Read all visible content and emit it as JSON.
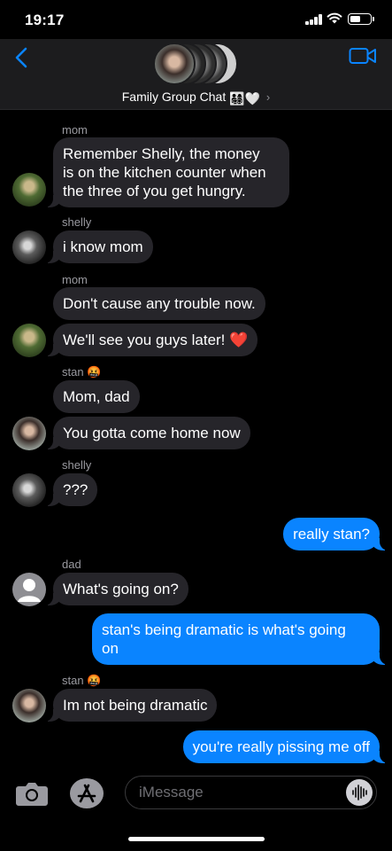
{
  "status": {
    "time": "19:17"
  },
  "header": {
    "title": "Family Group Chat",
    "title_emoji": "👨‍👩‍👧‍👦🤍",
    "chevron": "›"
  },
  "messages": [
    {
      "sender": "mom",
      "text_lines": [
        "Remember Shelly, the money",
        "is on the kitchen counter when",
        "the three of you get hungry."
      ],
      "direction": "received"
    },
    {
      "sender": "shelly",
      "text": "i know mom",
      "direction": "received"
    },
    {
      "sender": "mom",
      "text": "Don't cause any trouble now.",
      "direction": "received"
    },
    {
      "text": "We'll see you guys later! ❤️",
      "direction": "received"
    },
    {
      "sender": "stan 🤬",
      "text": "Mom, dad",
      "direction": "received"
    },
    {
      "text": "You gotta come home now",
      "direction": "received"
    },
    {
      "sender": "shelly",
      "text": "???",
      "direction": "received"
    },
    {
      "text": "really stan?",
      "direction": "sent"
    },
    {
      "sender": "dad",
      "text": "What's going on?",
      "direction": "received"
    },
    {
      "text_lines": [
        "stan's being dramatic is what's going",
        "on"
      ],
      "direction": "sent"
    },
    {
      "sender": "stan 🤬",
      "text": "Im not being dramatic",
      "direction": "received"
    },
    {
      "text": "you're really pissing me off",
      "direction": "sent"
    }
  ],
  "input": {
    "placeholder": "iMessage"
  },
  "colors": {
    "sent_bubble": "#0a84ff",
    "received_bubble": "#26252a",
    "background": "#000000",
    "accent": "#0a84ff"
  },
  "icons": [
    "back-chevron-icon",
    "video-call-icon",
    "camera-icon",
    "app-store-icon",
    "audio-waveform-icon"
  ]
}
